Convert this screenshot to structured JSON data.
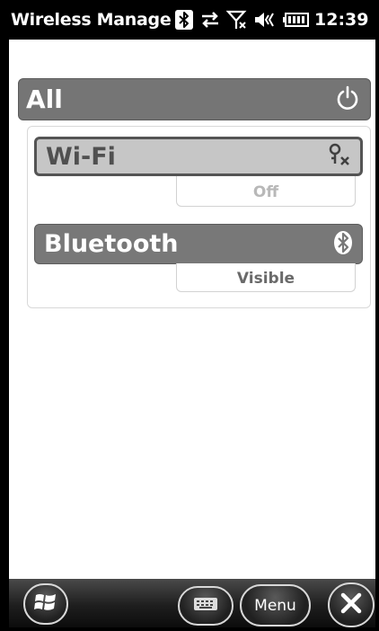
{
  "status_bar": {
    "title": "Wireless Manager",
    "time": "12:39",
    "icons": [
      "bluetooth-icon",
      "data-transfer-icon",
      "no-signal-icon",
      "volume-icon",
      "battery-icon"
    ]
  },
  "all_section": {
    "label": "All",
    "power_icon": "power-icon"
  },
  "radios": [
    {
      "label": "Wi-Fi",
      "state": "Off",
      "icon": "wifi-disabled-icon",
      "selected": true
    },
    {
      "label": "Bluetooth",
      "state": "Visible",
      "icon": "bluetooth-icon",
      "selected": false
    }
  ],
  "taskbar": {
    "start_icon": "windows-start-icon",
    "keyboard_icon": "keyboard-icon",
    "menu_label": "Menu",
    "close_icon": "close-icon"
  },
  "colors": {
    "status_bg": "#000000",
    "bar_gray": "#787878",
    "selected_bar": "#c6c6c6",
    "selected_border": "#545454"
  }
}
